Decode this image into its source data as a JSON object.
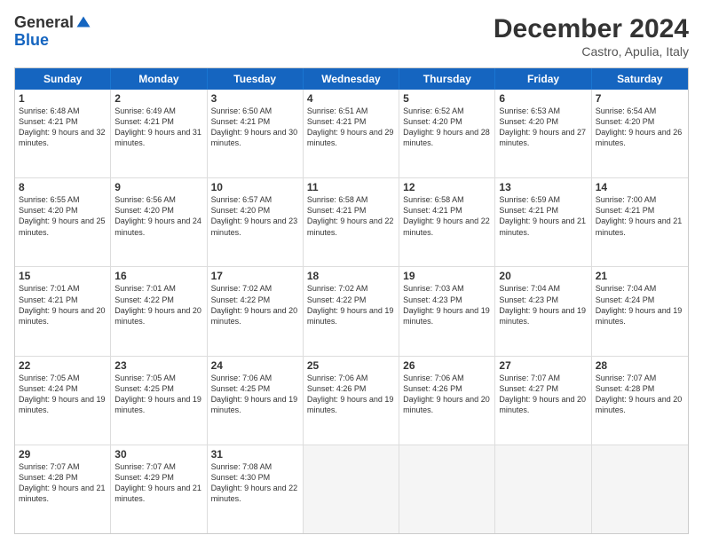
{
  "header": {
    "logo_general": "General",
    "logo_blue": "Blue",
    "month_title": "December 2024",
    "subtitle": "Castro, Apulia, Italy"
  },
  "days_of_week": [
    "Sunday",
    "Monday",
    "Tuesday",
    "Wednesday",
    "Thursday",
    "Friday",
    "Saturday"
  ],
  "weeks": [
    [
      {
        "day": "1",
        "sunrise": "6:48 AM",
        "sunset": "4:21 PM",
        "daylight": "9 hours and 32 minutes."
      },
      {
        "day": "2",
        "sunrise": "6:49 AM",
        "sunset": "4:21 PM",
        "daylight": "9 hours and 31 minutes."
      },
      {
        "day": "3",
        "sunrise": "6:50 AM",
        "sunset": "4:21 PM",
        "daylight": "9 hours and 30 minutes."
      },
      {
        "day": "4",
        "sunrise": "6:51 AM",
        "sunset": "4:21 PM",
        "daylight": "9 hours and 29 minutes."
      },
      {
        "day": "5",
        "sunrise": "6:52 AM",
        "sunset": "4:20 PM",
        "daylight": "9 hours and 28 minutes."
      },
      {
        "day": "6",
        "sunrise": "6:53 AM",
        "sunset": "4:20 PM",
        "daylight": "9 hours and 27 minutes."
      },
      {
        "day": "7",
        "sunrise": "6:54 AM",
        "sunset": "4:20 PM",
        "daylight": "9 hours and 26 minutes."
      }
    ],
    [
      {
        "day": "8",
        "sunrise": "6:55 AM",
        "sunset": "4:20 PM",
        "daylight": "9 hours and 25 minutes."
      },
      {
        "day": "9",
        "sunrise": "6:56 AM",
        "sunset": "4:20 PM",
        "daylight": "9 hours and 24 minutes."
      },
      {
        "day": "10",
        "sunrise": "6:57 AM",
        "sunset": "4:20 PM",
        "daylight": "9 hours and 23 minutes."
      },
      {
        "day": "11",
        "sunrise": "6:58 AM",
        "sunset": "4:21 PM",
        "daylight": "9 hours and 22 minutes."
      },
      {
        "day": "12",
        "sunrise": "6:58 AM",
        "sunset": "4:21 PM",
        "daylight": "9 hours and 22 minutes."
      },
      {
        "day": "13",
        "sunrise": "6:59 AM",
        "sunset": "4:21 PM",
        "daylight": "9 hours and 21 minutes."
      },
      {
        "day": "14",
        "sunrise": "7:00 AM",
        "sunset": "4:21 PM",
        "daylight": "9 hours and 21 minutes."
      }
    ],
    [
      {
        "day": "15",
        "sunrise": "7:01 AM",
        "sunset": "4:21 PM",
        "daylight": "9 hours and 20 minutes."
      },
      {
        "day": "16",
        "sunrise": "7:01 AM",
        "sunset": "4:22 PM",
        "daylight": "9 hours and 20 minutes."
      },
      {
        "day": "17",
        "sunrise": "7:02 AM",
        "sunset": "4:22 PM",
        "daylight": "9 hours and 20 minutes."
      },
      {
        "day": "18",
        "sunrise": "7:02 AM",
        "sunset": "4:22 PM",
        "daylight": "9 hours and 19 minutes."
      },
      {
        "day": "19",
        "sunrise": "7:03 AM",
        "sunset": "4:23 PM",
        "daylight": "9 hours and 19 minutes."
      },
      {
        "day": "20",
        "sunrise": "7:04 AM",
        "sunset": "4:23 PM",
        "daylight": "9 hours and 19 minutes."
      },
      {
        "day": "21",
        "sunrise": "7:04 AM",
        "sunset": "4:24 PM",
        "daylight": "9 hours and 19 minutes."
      }
    ],
    [
      {
        "day": "22",
        "sunrise": "7:05 AM",
        "sunset": "4:24 PM",
        "daylight": "9 hours and 19 minutes."
      },
      {
        "day": "23",
        "sunrise": "7:05 AM",
        "sunset": "4:25 PM",
        "daylight": "9 hours and 19 minutes."
      },
      {
        "day": "24",
        "sunrise": "7:06 AM",
        "sunset": "4:25 PM",
        "daylight": "9 hours and 19 minutes."
      },
      {
        "day": "25",
        "sunrise": "7:06 AM",
        "sunset": "4:26 PM",
        "daylight": "9 hours and 19 minutes."
      },
      {
        "day": "26",
        "sunrise": "7:06 AM",
        "sunset": "4:26 PM",
        "daylight": "9 hours and 20 minutes."
      },
      {
        "day": "27",
        "sunrise": "7:07 AM",
        "sunset": "4:27 PM",
        "daylight": "9 hours and 20 minutes."
      },
      {
        "day": "28",
        "sunrise": "7:07 AM",
        "sunset": "4:28 PM",
        "daylight": "9 hours and 20 minutes."
      }
    ],
    [
      {
        "day": "29",
        "sunrise": "7:07 AM",
        "sunset": "4:28 PM",
        "daylight": "9 hours and 21 minutes."
      },
      {
        "day": "30",
        "sunrise": "7:07 AM",
        "sunset": "4:29 PM",
        "daylight": "9 hours and 21 minutes."
      },
      {
        "day": "31",
        "sunrise": "7:08 AM",
        "sunset": "4:30 PM",
        "daylight": "9 hours and 22 minutes."
      },
      null,
      null,
      null,
      null
    ]
  ]
}
